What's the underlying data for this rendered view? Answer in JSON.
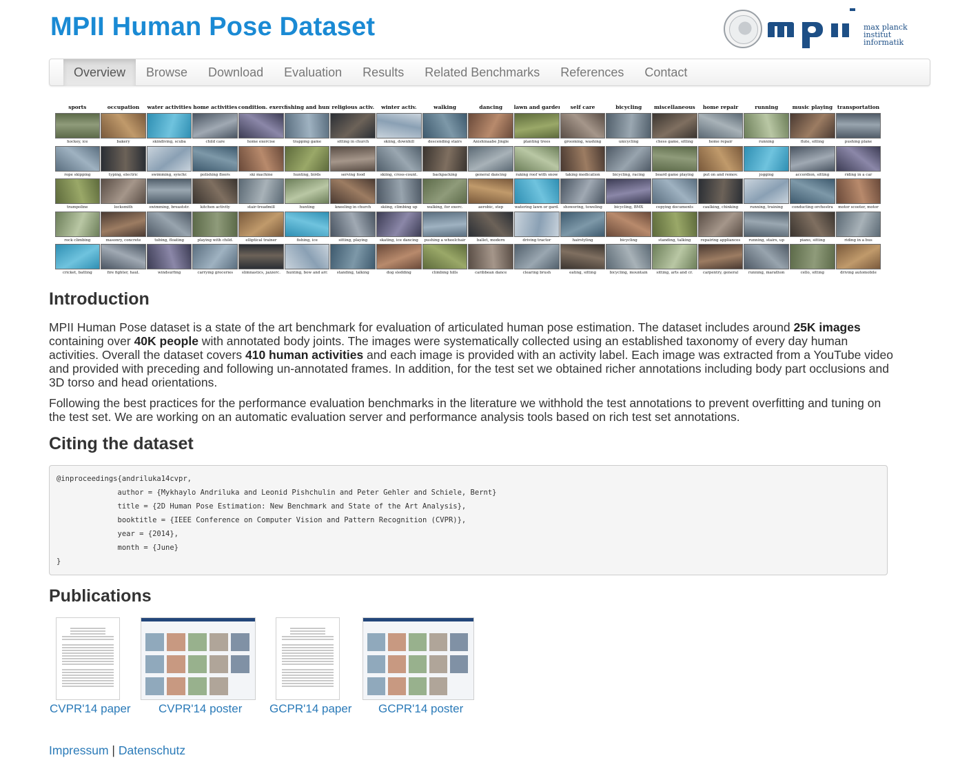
{
  "header": {
    "title": "MPII Human Pose Dataset",
    "logo": {
      "mark": "mpii",
      "line1": "max planck institut",
      "line2": "informatik"
    }
  },
  "nav": {
    "items": [
      "Overview",
      "Browse",
      "Download",
      "Evaluation",
      "Results",
      "Related Benchmarks",
      "References",
      "Contact"
    ],
    "active_index": 0
  },
  "collage": {
    "categories": [
      "sports",
      "occupation",
      "water activities",
      "home activities",
      "condition. exerc.",
      "fishing and hunt.",
      "religious activ.",
      "winter activ.",
      "walking",
      "dancing",
      "lawn and garden",
      "self care",
      "bicycling",
      "miscellaneous",
      "home repair",
      "running",
      "music playing",
      "transportation"
    ],
    "rows": [
      [
        "hockey, ice",
        "bakery",
        "skindiving, scuba",
        "child care",
        "home exercise",
        "trapping game",
        "sitting in church",
        "skiing, downhill",
        "descending stairs",
        "Anishinaabe Jingle",
        "planting trees",
        "grooming, washing",
        "unicycling",
        "chess game, sitting",
        "home repair",
        "running",
        "flute, sitting",
        "pushing plane"
      ],
      [
        "rope skipping",
        "typing, electric",
        "swimming, synchr.",
        "polishing floors",
        "ski machine",
        "hunting, birds",
        "serving food",
        "skiing, cross-count.",
        "backpacking",
        "general dancing",
        "raking roof with snow",
        "taking medication",
        "bicycling, racing",
        "board game playing",
        "put on and remov.",
        "jogging",
        "accordion, sitting",
        "riding in a car"
      ],
      [
        "trampoline",
        "locksmith",
        "swimming, breaststr.",
        "kitchen activity",
        "stair-treadmill",
        "hunting",
        "kneeling in church",
        "skiing, climbing up",
        "walking, for exerc.",
        "aerobic, step",
        "watering lawn or gard.",
        "showering, toweling",
        "bicycling, BMX",
        "copying documents",
        "caulking, chinking",
        "running, training",
        "conducting orchestra",
        "motor scooter, motor"
      ],
      [
        "rock climbing",
        "masonry, concrete",
        "tubing, floating",
        "playing with child.",
        "elliptical trainer",
        "fishing, ice",
        "sitting, playing",
        "skating, ice dancing",
        "pushing a wheelchair",
        "ballet, modern",
        "driving tractor",
        "hairstyling",
        "bicycling",
        "standing, talking",
        "repairing appliances",
        "running, stairs, up",
        "piano, sitting",
        "riding in a bus"
      ],
      [
        "cricket, batting",
        "fire fighter, haul.",
        "windsurfing",
        "carrying groceries",
        "slimnastics, jazzerc.",
        "hunting, bow and arr.",
        "standing, talking",
        "dog sledding",
        "climbing hills",
        "caribbean dance",
        "clearing brush",
        "eating, sitting",
        "bicycling, mountain",
        "sitting, arts and cr.",
        "carpentry, general",
        "running, marathon",
        "cello, sitting",
        "driving automobile"
      ]
    ]
  },
  "intro": {
    "heading": "Introduction",
    "p1": {
      "t1": "MPII Human Pose dataset is a state of the art benchmark for evaluation of articulated human pose estimation. The dataset includes around ",
      "b1": "25K images",
      "t2": " containing over ",
      "b2": "40K people",
      "t3": " with annotated body joints. The images were systematically collected using an established taxonomy of every day human activities. Overall the dataset covers ",
      "b3": "410 human activities",
      "t4": " and each image is provided with an activity label. Each image was extracted from a YouTube video and provided with preceding and following un-annotated frames. In addition, for the test set we obtained richer annotations including body part occlusions and 3D torso and head orientations."
    },
    "p2": "Following the best practices for the performance evaluation benchmarks in the literature we withhold the test annotations to prevent overfitting and tuning on the test set. We are working on an automatic evaluation server and performance analysis tools based on rich test set annotations."
  },
  "citing": {
    "heading": "Citing the dataset",
    "bibtex": [
      "@inproceedings{andriluka14cvpr,",
      "              author = {Mykhaylo Andriluka and Leonid Pishchulin and Peter Gehler and Schiele, Bernt}",
      "              title = {2D Human Pose Estimation: New Benchmark and State of the Art Analysis},",
      "              booktitle = {IEEE Conference on Computer Vision and Pattern Recognition (CVPR)},",
      "              year = {2014},",
      "              month = {June}",
      "}"
    ]
  },
  "publications": {
    "heading": "Publications",
    "items": [
      {
        "label": "CVPR'14 paper",
        "kind": "paper"
      },
      {
        "label": "CVPR'14 poster",
        "kind": "poster"
      },
      {
        "label": "GCPR'14 paper",
        "kind": "paper"
      },
      {
        "label": "GCPR'14 poster",
        "kind": "poster"
      }
    ]
  },
  "footer": {
    "impressum": "Impressum",
    "separator": "|",
    "datenschutz": "Datenschutz"
  },
  "colors": {
    "title_blue": "#1a8ad4",
    "link_blue": "#2a7ab8",
    "logo_blue": "#1d4f86"
  }
}
